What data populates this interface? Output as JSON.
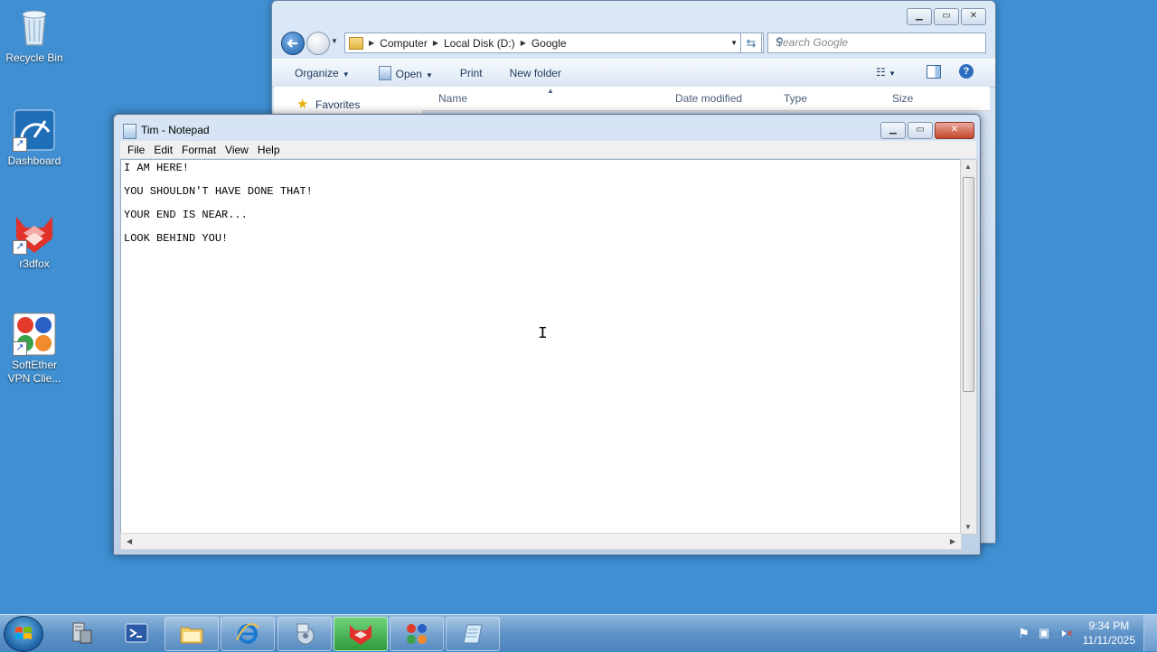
{
  "desktop": {
    "icons": [
      {
        "label": "Recycle Bin",
        "icon": "recycle-bin-icon"
      },
      {
        "label": "Dashboard",
        "icon": "dashboard-icon"
      },
      {
        "label": "r3dfox",
        "icon": "r3dfox-icon"
      },
      {
        "label": "SoftEther\nVPN Clie...",
        "icon": "softether-icon"
      }
    ]
  },
  "explorer": {
    "breadcrumb": [
      "Computer",
      "Local Disk (D:)",
      "Google"
    ],
    "search_placeholder": "Search Google",
    "toolbar": {
      "organize": "Organize",
      "open": "Open",
      "print": "Print",
      "new_folder": "New folder"
    },
    "columns": {
      "name": "Name",
      "date_modified": "Date modified",
      "type": "Type",
      "size": "Size"
    },
    "sidebar": {
      "favorites": "Favorites"
    }
  },
  "notepad": {
    "title": "Tim - Notepad",
    "menu": [
      "File",
      "Edit",
      "Format",
      "View",
      "Help"
    ],
    "lines": [
      "I AM HERE!",
      "YOU SHOULDN'T HAVE DONE THAT!",
      "YOUR END IS NEAR...",
      "LOOK BEHIND YOU!"
    ]
  },
  "taskbar": {
    "items": [
      {
        "name": "server-manager",
        "icon": "server-manager-icon"
      },
      {
        "name": "powershell",
        "icon": "powershell-icon"
      },
      {
        "name": "windows-explorer",
        "icon": "folder-icon"
      },
      {
        "name": "internet-explorer",
        "icon": "internet-explorer-icon"
      },
      {
        "name": "media-player",
        "icon": "media-player-icon"
      },
      {
        "name": "r3dfox",
        "icon": "r3dfox-icon"
      },
      {
        "name": "softether",
        "icon": "softether-icon"
      },
      {
        "name": "notepad",
        "icon": "notepad-icon"
      }
    ],
    "clock": {
      "time": "9:34 PM",
      "date": "11/11/2025"
    }
  }
}
